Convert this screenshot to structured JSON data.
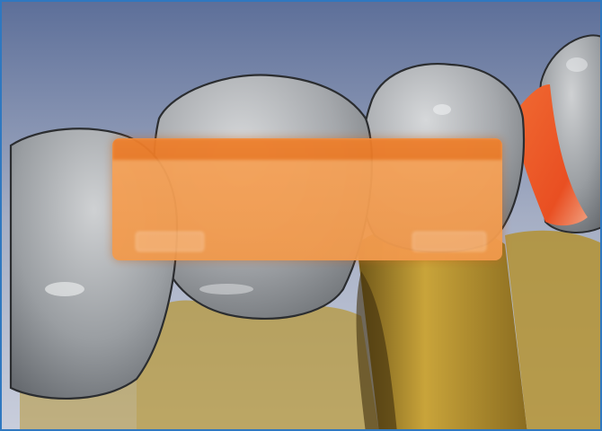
{
  "scene": {
    "subject": "3d-dental-scan",
    "colors": {
      "background_top": "#5d6f99",
      "background_bottom": "#c9cedc",
      "tooth": "#a3a6aa",
      "gingiva": "#b69431",
      "highlight_region": "#ef5f2a",
      "frame_border": "#2f78c0"
    }
  },
  "dialog": {
    "title": "",
    "body_lines": [
      "",
      "",
      "",
      ""
    ],
    "buttons": {
      "left": "",
      "right": ""
    },
    "colors": {
      "body": "#f4a052",
      "title_bar": "#ec7c28"
    }
  }
}
